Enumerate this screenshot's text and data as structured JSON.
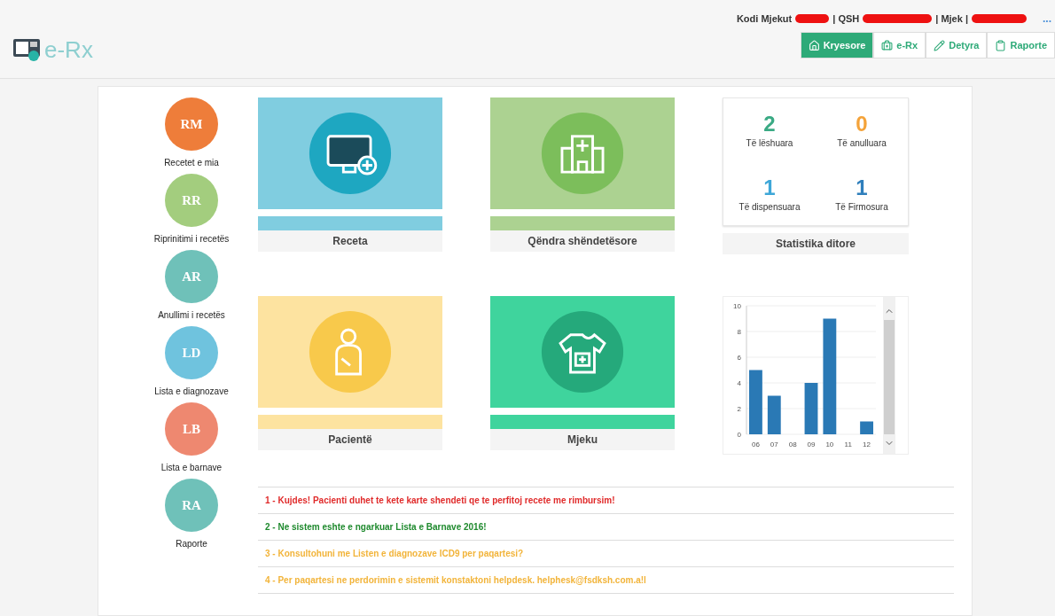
{
  "header": {
    "user_info": [
      {
        "label": "Kodi Mjekut",
        "redacted": true
      },
      {
        "label": "| QSH",
        "redacted": true
      },
      {
        "label": "| Mjek |",
        "redacted": true
      }
    ],
    "more": "..."
  },
  "logo": {
    "text": "e-Rx"
  },
  "nav_tabs": [
    {
      "label": "Kryesore",
      "selected": true
    },
    {
      "label": "e-Rx",
      "selected": false
    },
    {
      "label": "Detyra",
      "selected": false
    },
    {
      "label": "Raporte",
      "selected": false
    }
  ],
  "shortcuts": [
    {
      "initials": "RM",
      "label": "Recetet e mia",
      "color": "#ee7d3a"
    },
    {
      "initials": "RR",
      "label": "Riprinitimi i recetës",
      "color": "#a3cd7e"
    },
    {
      "initials": "AR",
      "label": "Anullimi i recetës",
      "color": "#6fc1b9"
    },
    {
      "initials": "LD",
      "label": "Lista e diagnozave",
      "color": "#6fc3de"
    },
    {
      "initials": "LB",
      "label": "Lista e barnave",
      "color": "#ee8870"
    },
    {
      "initials": "RA",
      "label": "Raporte",
      "color": "#6fc1b9"
    }
  ],
  "tiles": [
    {
      "label": "Receta",
      "kind": "prescription",
      "color": "#80cde0"
    },
    {
      "label": "Qëndra shëndetësore",
      "kind": "hospital",
      "color": "#acd291"
    },
    {
      "label": "Pacientë",
      "kind": "patient",
      "color": "#fde3a0"
    },
    {
      "label": "Mjeku",
      "kind": "doctor",
      "color": "#3fd49d"
    }
  ],
  "statistics": {
    "title": "Statistika ditore",
    "items": [
      {
        "value": "2",
        "label": "Të lëshuara",
        "color": "#3aaa84"
      },
      {
        "value": "0",
        "label": "Të anulluara",
        "color": "#f4a33a"
      },
      {
        "value": "1",
        "label": "Të dispensuara",
        "color": "#3ea7d8"
      },
      {
        "value": "1",
        "label": "Të Firmosura",
        "color": "#2f7fbc"
      }
    ]
  },
  "chart_data": {
    "type": "bar",
    "categories": [
      "06",
      "07",
      "08",
      "09",
      "10",
      "11",
      "12"
    ],
    "series": [
      {
        "color": "#2a79b5",
        "values": [
          5,
          3,
          0,
          4,
          9,
          0,
          1
        ]
      }
    ],
    "ylim": [
      0,
      10
    ],
    "yticks": [
      0,
      2,
      4,
      6,
      8,
      10
    ],
    "grid": true
  },
  "messages": [
    {
      "text": "1 - Kujdes! Pacienti duhet te kete karte shendeti qe te perfitoj recete me rimbursim!",
      "color": "#e02a2a"
    },
    {
      "text": "2 - Ne sistem eshte e ngarkuar Lista e Barnave 2016!",
      "color": "#1f8a2e"
    },
    {
      "text": "3 - Konsultohuni me Listen e diagnozave ICD9 per paqartesi?",
      "color": "#f2b43a"
    },
    {
      "text": "4 - Per paqartesi ne perdorimin e sistemit konstaktoni helpdesk. helphesk@fsdksh.com.a!l",
      "color": "#f2b43a"
    }
  ]
}
